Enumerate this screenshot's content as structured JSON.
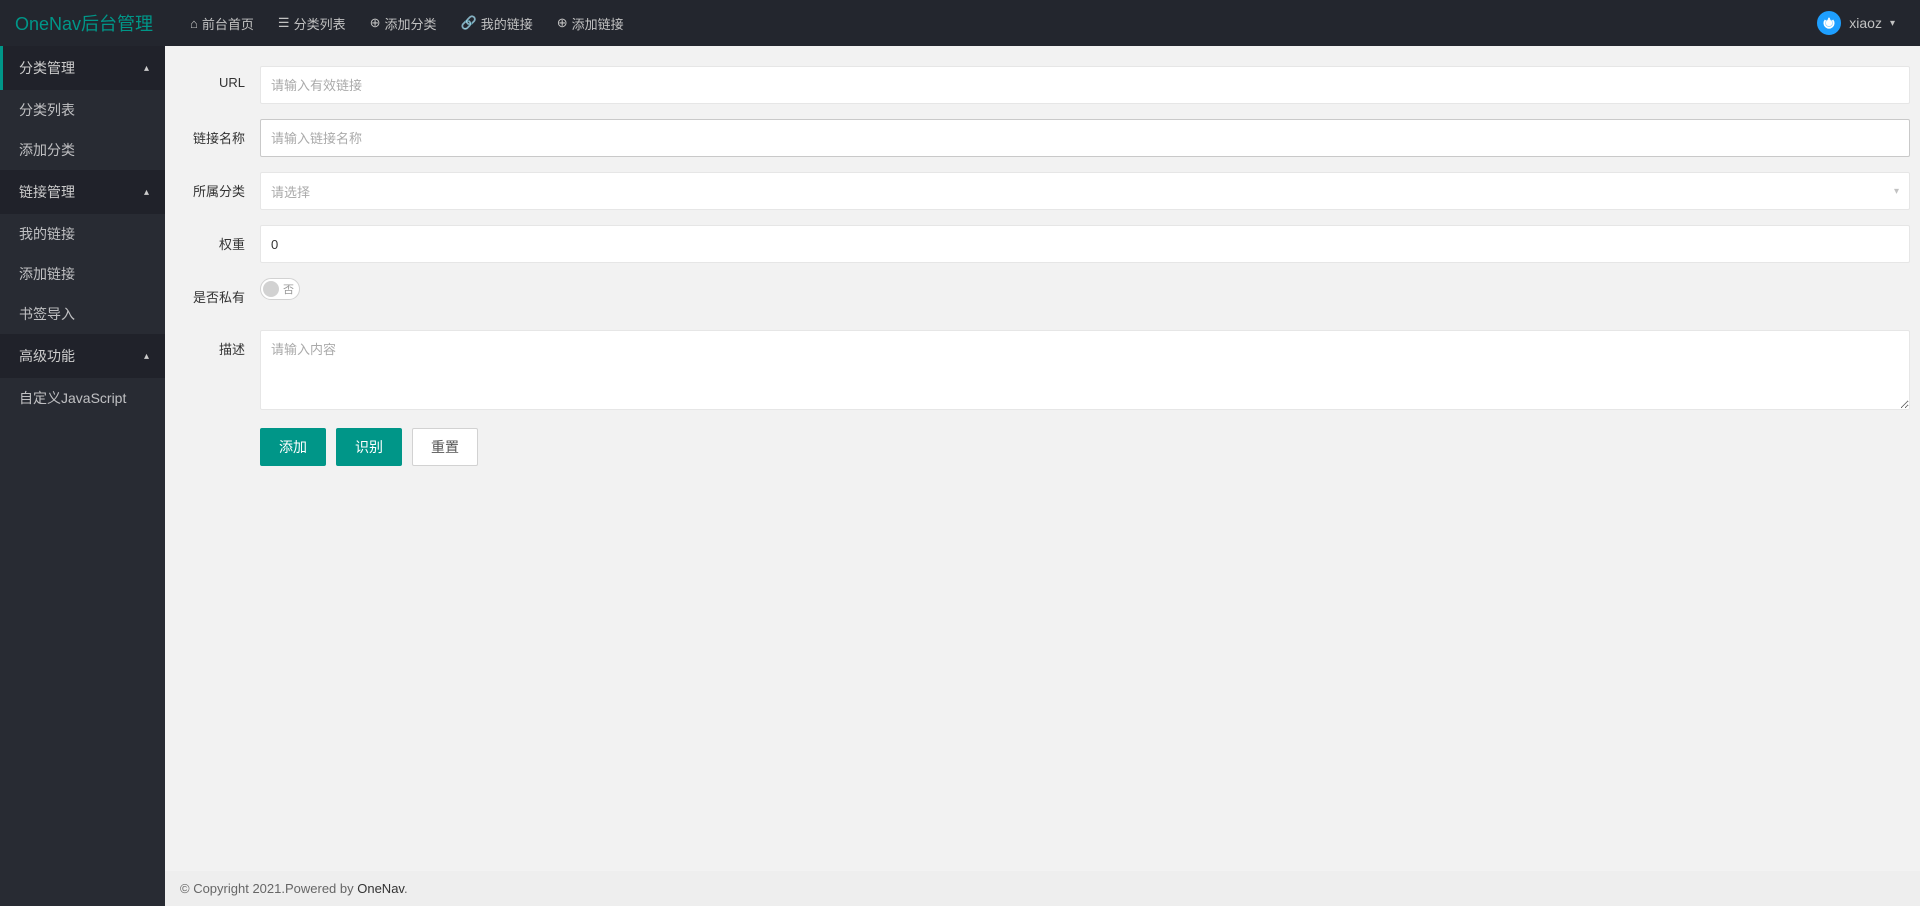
{
  "header": {
    "logo": "OneNav后台管理",
    "nav": [
      {
        "icon": "home",
        "label": "前台首页"
      },
      {
        "icon": "list",
        "label": "分类列表"
      },
      {
        "icon": "plus",
        "label": "添加分类"
      },
      {
        "icon": "link",
        "label": "我的链接"
      },
      {
        "icon": "plus",
        "label": "添加链接"
      }
    ],
    "user": "xiaoz"
  },
  "sidebar": {
    "groups": [
      {
        "title": "分类管理",
        "items": [
          {
            "label": "分类列表"
          },
          {
            "label": "添加分类"
          }
        ]
      },
      {
        "title": "链接管理",
        "items": [
          {
            "label": "我的链接"
          },
          {
            "label": "添加链接"
          },
          {
            "label": "书签导入"
          }
        ]
      },
      {
        "title": "高级功能",
        "items": [
          {
            "label": "自定义JavaScript"
          }
        ]
      }
    ]
  },
  "form": {
    "url": {
      "label": "URL",
      "placeholder": "请输入有效链接",
      "value": ""
    },
    "name": {
      "label": "链接名称",
      "placeholder": "请输入链接名称",
      "value": ""
    },
    "category": {
      "label": "所属分类",
      "placeholder": "请选择"
    },
    "weight": {
      "label": "权重",
      "value": "0"
    },
    "private": {
      "label": "是否私有",
      "text": "否"
    },
    "description": {
      "label": "描述",
      "placeholder": "请输入内容",
      "value": ""
    },
    "buttons": {
      "submit": "添加",
      "identify": "识别",
      "reset": "重置"
    }
  },
  "footer": {
    "copyright": "© Copyright 2021.Powered by ",
    "link": "OneNav",
    "suffix": "."
  }
}
